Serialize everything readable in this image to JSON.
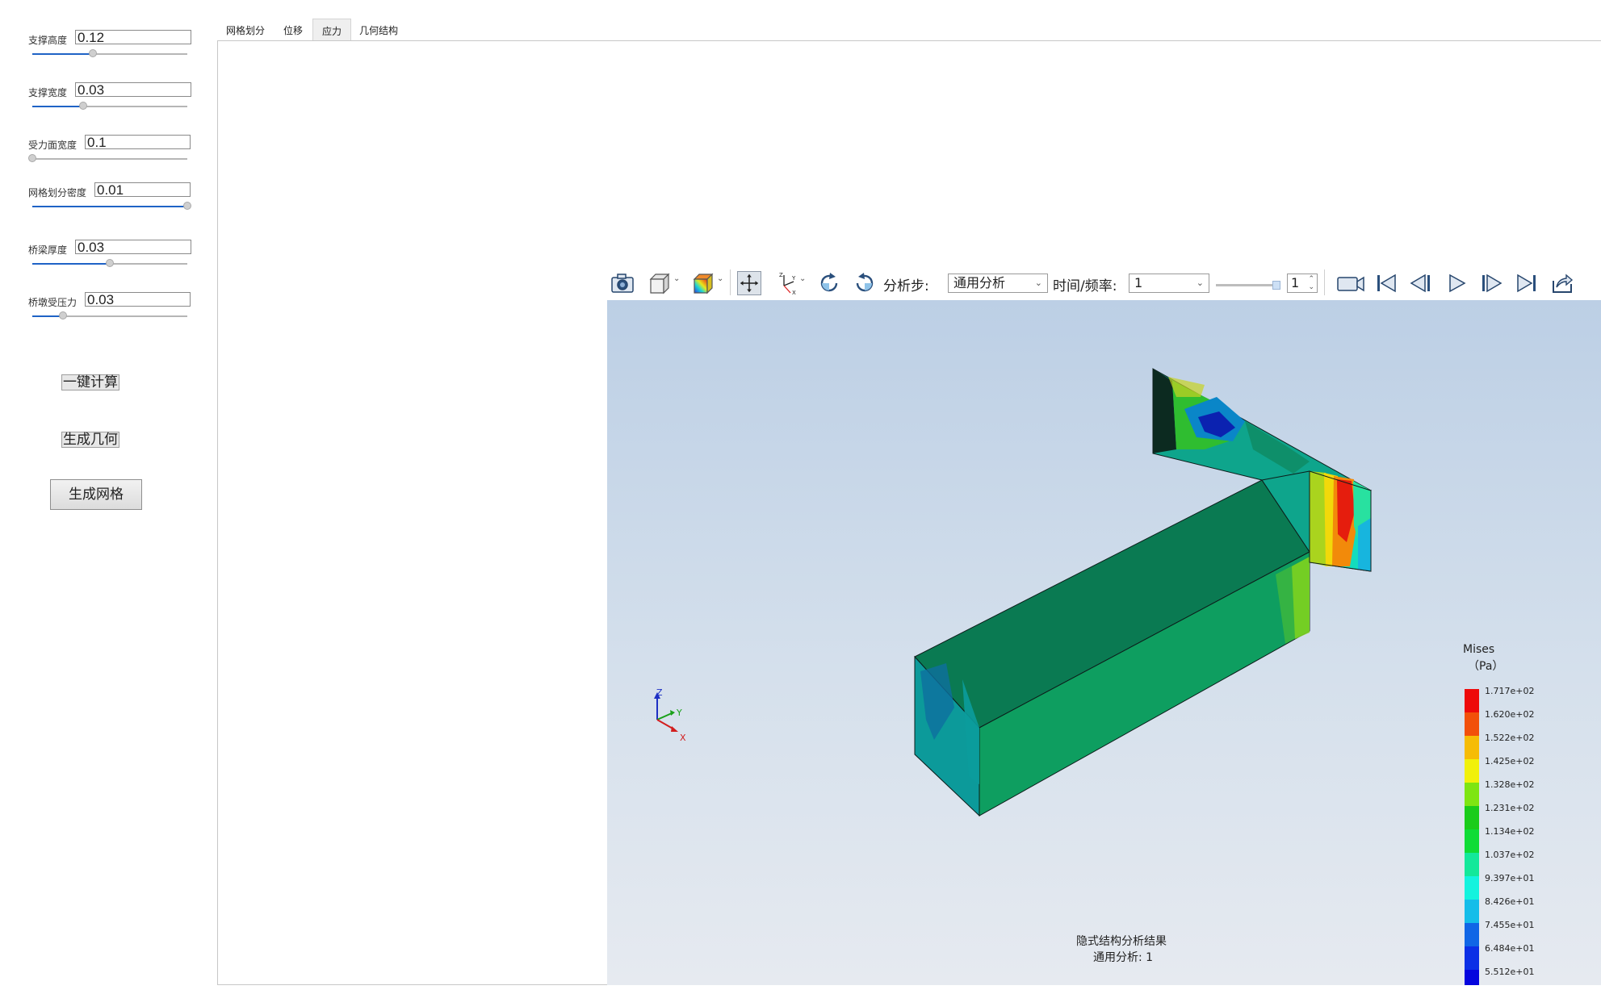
{
  "params": [
    {
      "label": "支撑高度",
      "value": "0.12",
      "level": 0.39
    },
    {
      "label": "支撑宽度",
      "value": "0.03",
      "level": 0.33
    },
    {
      "label": "受力面宽度",
      "value": "0.1",
      "level": 0.0
    },
    {
      "label": "网格划分密度",
      "value": "0.01",
      "level": 1.0
    },
    {
      "label": "桥梁厚度",
      "value": "0.03",
      "level": 0.5
    },
    {
      "label": "桥墩受压力",
      "value": "0.03",
      "level": 0.2
    }
  ],
  "buttons": {
    "compute": "一键计算",
    "geometry": "生成几何",
    "mesh": "生成网格"
  },
  "tabs": [
    "网格划分",
    "位移",
    "应力",
    "几何结构"
  ],
  "active_tab": "应力",
  "toolbar": {
    "step_label": "分析步:",
    "step_value": "通用分析",
    "time_label": "时间/频率:",
    "time_value": "1",
    "frame_value": "1",
    "icons": [
      "camera-icon",
      "view-cube-icon",
      "color-map-icon",
      "pan-icon",
      "axis-triad-icon",
      "rotate-cw-icon",
      "rotate-ccw-icon",
      "record-video-icon",
      "first-frame-icon",
      "prev-frame-icon",
      "play-icon",
      "next-frame-icon",
      "last-frame-icon",
      "export-icon"
    ]
  },
  "legend": {
    "title": "Mises",
    "unit": "（Pa）",
    "labels": [
      "1.717e+02",
      "1.620e+02",
      "1.522e+02",
      "1.425e+02",
      "1.328e+02",
      "1.231e+02",
      "1.134e+02",
      "1.037e+02",
      "9.397e+01",
      "8.426e+01",
      "7.455e+01",
      "6.484e+01",
      "5.512e+01"
    ],
    "colors": [
      "#ee0a0a",
      "#f2500a",
      "#f6bc06",
      "#f1f10a",
      "#7ee512",
      "#1acc1a",
      "#0fdc36",
      "#13e89a",
      "#14f3de",
      "#14bde9",
      "#1066e6",
      "#0c30e6",
      "#0505de"
    ]
  },
  "caption": {
    "line1": "隐式结构分析结果",
    "line2": "通用分析: 1"
  },
  "triad": {
    "z": "Z",
    "y": "Y",
    "x": "X"
  }
}
